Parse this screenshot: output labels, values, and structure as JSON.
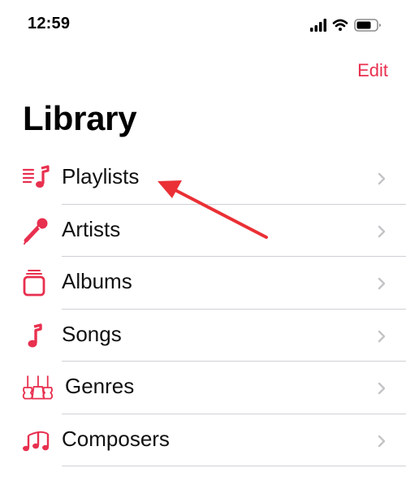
{
  "status_bar": {
    "time": "12:59"
  },
  "header": {
    "edit_label": "Edit",
    "title": "Library"
  },
  "library": {
    "items": [
      {
        "label": "Playlists",
        "icon": "playlists-icon"
      },
      {
        "label": "Artists",
        "icon": "microphone-icon"
      },
      {
        "label": "Albums",
        "icon": "albums-stack-icon"
      },
      {
        "label": "Songs",
        "icon": "music-note-icon"
      },
      {
        "label": "Genres",
        "icon": "guitars-icon"
      },
      {
        "label": "Composers",
        "icon": "music-notes-icon"
      }
    ]
  },
  "colors": {
    "accent": "#e8304f",
    "annotation": "#ea3035",
    "divider": "#d1d1d6",
    "chevron": "#c4c4c7"
  }
}
